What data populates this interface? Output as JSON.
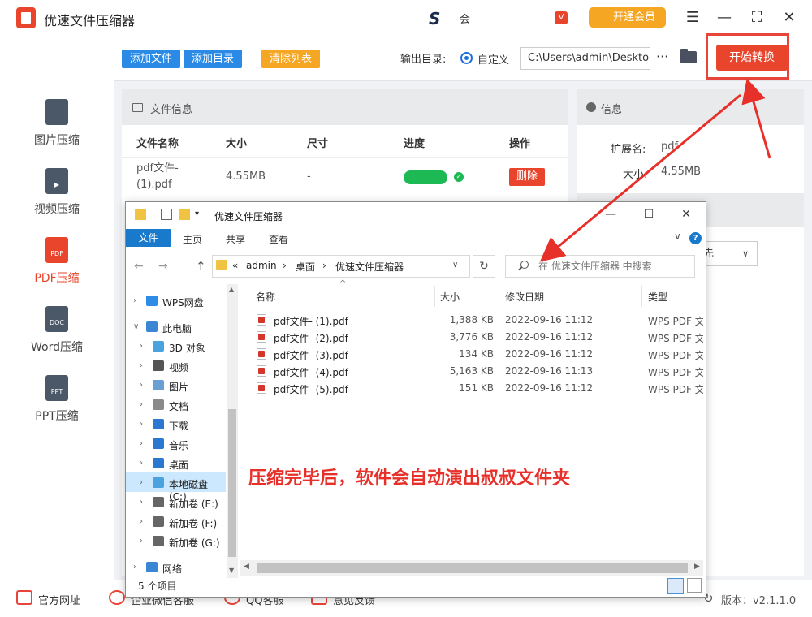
{
  "app": {
    "title": "优速文件压缩器",
    "center_text": "会",
    "vip_small": "V",
    "vip_button": "开通会员"
  },
  "window_controls": {
    "menu": "☰",
    "minimize": "—",
    "maximize": "⛶",
    "close": "✕"
  },
  "sidebar": {
    "items": [
      {
        "label": "图片压缩",
        "tag": ""
      },
      {
        "label": "视频压缩",
        "tag": "▶"
      },
      {
        "label": "PDF压缩",
        "tag": "PDF"
      },
      {
        "label": "Word压缩",
        "tag": "DOC"
      },
      {
        "label": "PPT压缩",
        "tag": "PPT"
      }
    ],
    "active_index": 2
  },
  "toolbar": {
    "add_file": "添加文件",
    "add_dir": "添加目录",
    "clear_list": "清除列表",
    "output_label": "输出目录:",
    "radio_label": "自定义",
    "output_path": "C:\\Users\\admin\\Deskto",
    "more": "···",
    "start": "开始转换"
  },
  "file_panel": {
    "title": "文件信息",
    "columns": [
      "文件名称",
      "大小",
      "尺寸",
      "进度",
      "操作"
    ],
    "row": {
      "name_line1": "pdf文件-",
      "name_line2": "(1).pdf",
      "size": "4.55MB",
      "dimension": "-",
      "progress": 1.0,
      "progress_check": "✓",
      "action": "删除"
    }
  },
  "info_panel": {
    "title": "信息",
    "ext_label": "扩展名:",
    "ext_value": "pdf",
    "size_label": "大小:",
    "size_value": "4.55MB",
    "select_value": "先"
  },
  "statusbar": {
    "items": [
      "官方网址",
      "企业微信客服",
      "QQ客服",
      "意见反馈"
    ],
    "version_icon": "↻",
    "version": "版本：v2.1.1.0"
  },
  "explorer": {
    "title": "优速文件压缩器",
    "qa_dropdown": "▾",
    "controls": {
      "minimize": "—",
      "maximize": "☐",
      "close": "✕"
    },
    "ribbon": {
      "file": "文件",
      "home": "主页",
      "share": "共享",
      "view": "查看",
      "chevron": "∨",
      "help": "?"
    },
    "nav": {
      "back": "←",
      "forward": "→",
      "up": "↑",
      "refresh": "↻",
      "addr_dropdown": "∨"
    },
    "breadcrumb": [
      "«",
      "admin",
      "›",
      "桌面",
      "›",
      "优速文件压缩器"
    ],
    "search_placeholder": "在 优速文件压缩器 中搜索",
    "tree": [
      {
        "label": "WPS网盘",
        "arrow": "›",
        "icon_color": "#2c8ce6",
        "level": 0
      },
      {
        "label": "此电脑",
        "arrow": "∨",
        "icon_color": "#3a86d4",
        "level": 0
      },
      {
        "label": "3D 对象",
        "arrow": "›",
        "icon_color": "#4aa3df",
        "level": 1
      },
      {
        "label": "视频",
        "arrow": "›",
        "icon_color": "#555555",
        "level": 1
      },
      {
        "label": "图片",
        "arrow": "›",
        "icon_color": "#6a9fd4",
        "level": 1
      },
      {
        "label": "文档",
        "arrow": "›",
        "icon_color": "#8a8a8a",
        "level": 1
      },
      {
        "label": "下载",
        "arrow": "›",
        "icon_color": "#2a78d0",
        "level": 1
      },
      {
        "label": "音乐",
        "arrow": "›",
        "icon_color": "#2a78d0",
        "level": 1
      },
      {
        "label": "桌面",
        "arrow": "›",
        "icon_color": "#2a78d0",
        "level": 1
      },
      {
        "label": "本地磁盘 (C:)",
        "arrow": "›",
        "icon_color": "#4aa3df",
        "level": 1
      },
      {
        "label": "新加卷 (E:)",
        "arrow": "›",
        "icon_color": "#666666",
        "level": 1
      },
      {
        "label": "新加卷 (F:)",
        "arrow": "›",
        "icon_color": "#666666",
        "level": 1
      },
      {
        "label": "新加卷 (G:)",
        "arrow": "›",
        "icon_color": "#666666",
        "level": 1
      },
      {
        "label": "网络",
        "arrow": "›",
        "icon_color": "#3a86d4",
        "level": 0
      }
    ],
    "tree_selected_index": 9,
    "scroll": {
      "up": "▲",
      "down": "▼",
      "left": "◀",
      "right": "▶"
    },
    "list_columns": [
      "名称",
      "大小",
      "修改日期",
      "类型"
    ],
    "sort_arrow": "^",
    "files": [
      {
        "name": "pdf文件- (1).pdf",
        "size": "1,388 KB",
        "date": "2022-09-16 11:12",
        "type": "WPS PDF 文"
      },
      {
        "name": "pdf文件- (2).pdf",
        "size": "3,776 KB",
        "date": "2022-09-16 11:12",
        "type": "WPS PDF 文"
      },
      {
        "name": "pdf文件- (3).pdf",
        "size": "134 KB",
        "date": "2022-09-16 11:12",
        "type": "WPS PDF 文"
      },
      {
        "name": "pdf文件- (4).pdf",
        "size": "5,163 KB",
        "date": "2022-09-16 11:13",
        "type": "WPS PDF 文"
      },
      {
        "name": "pdf文件- (5).pdf",
        "size": "151 KB",
        "date": "2022-09-16 11:12",
        "type": "WPS PDF 文"
      }
    ],
    "count": "5 个项目"
  },
  "annotation": "压缩完毕后，软件会自动演出叔叔文件夹",
  "colors": {
    "accent_red": "#e8452c",
    "blue_btn": "#2a8ae6",
    "orange_btn": "#f5a623",
    "green": "#1db954"
  }
}
